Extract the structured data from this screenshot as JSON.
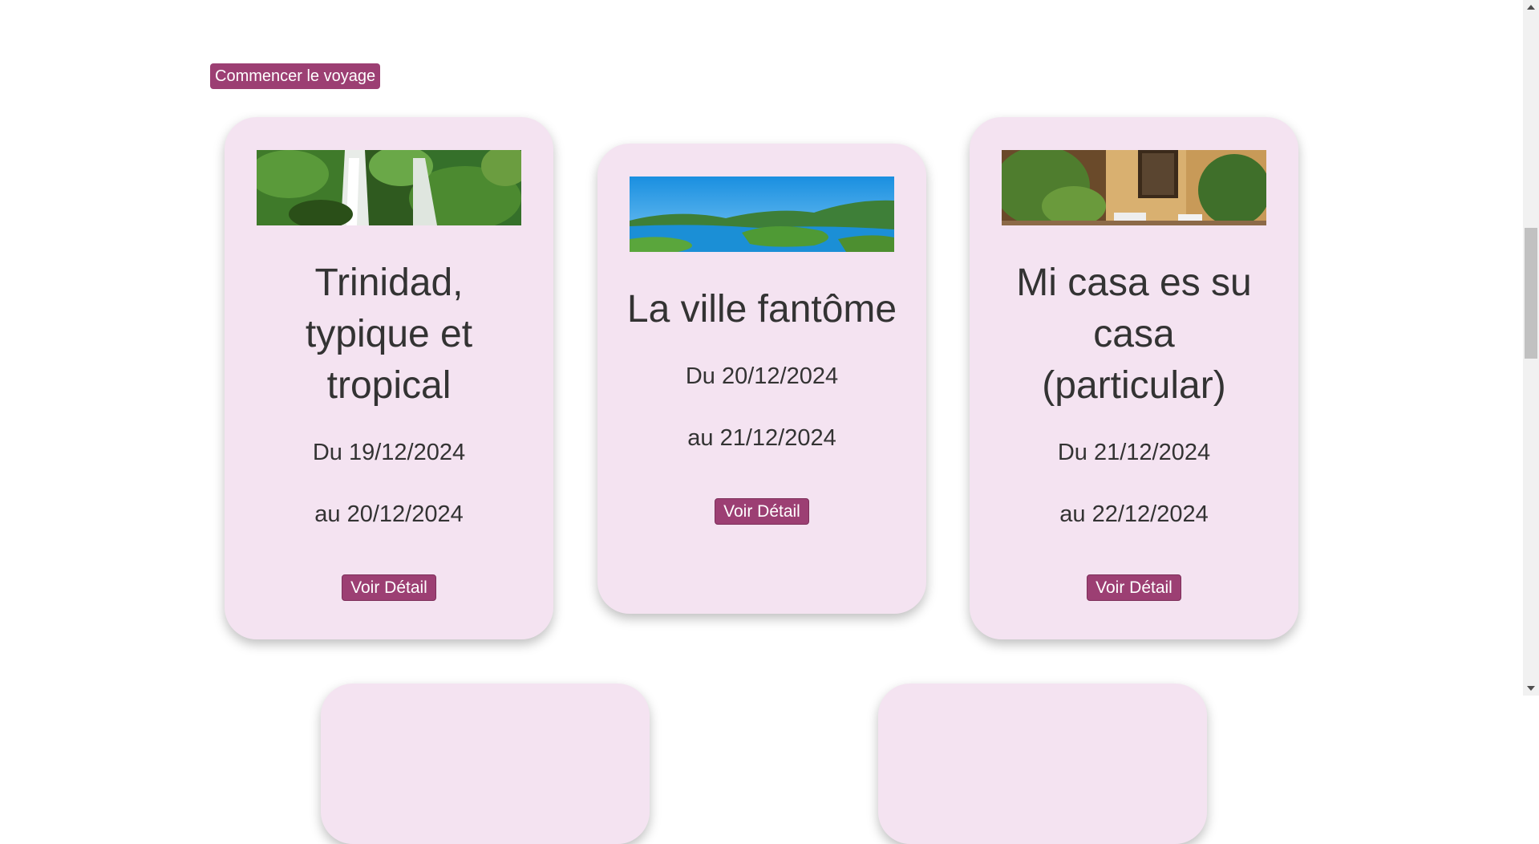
{
  "start_button": {
    "label": "Commencer le voyage"
  },
  "cards": [
    {
      "title": "Trinidad, typique et tropical",
      "date_from": "Du 19/12/2024",
      "date_to": "au 20/12/2024",
      "button": "Voir Détail",
      "image": "waterfall-image"
    },
    {
      "title": "La ville fantôme",
      "date_from": "Du 20/12/2024",
      "date_to": "au 21/12/2024",
      "button": "Voir Détail",
      "image": "lake-landscape-image"
    },
    {
      "title": "Mi casa es su casa (particular)",
      "date_from": "Du 21/12/2024",
      "date_to": "au 22/12/2024",
      "button": "Voir Détail",
      "image": "courtyard-image"
    }
  ],
  "colors": {
    "accent": "#9c3f73",
    "card_bg": "#f4e3f1",
    "text": "#333333"
  }
}
